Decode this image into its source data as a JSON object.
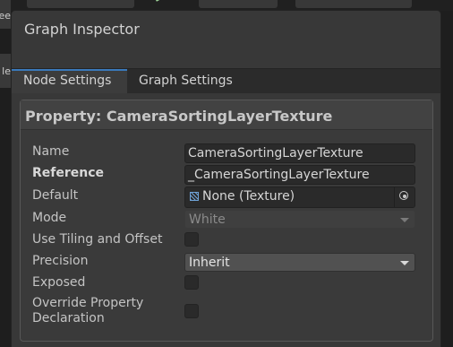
{
  "background": {
    "left_labels": [
      "ee",
      "le"
    ]
  },
  "panel": {
    "title": "Graph Inspector",
    "tabs": [
      {
        "label": "Node Settings",
        "active": true
      },
      {
        "label": "Graph Settings",
        "active": false
      }
    ]
  },
  "property": {
    "header": "Property: CameraSortingLayerTexture",
    "rows": {
      "name": {
        "label": "Name",
        "value": "CameraSortingLayerTexture"
      },
      "reference": {
        "label": "Reference",
        "value": "_CameraSortingLayerTexture"
      },
      "default": {
        "label": "Default",
        "value": "None (Texture)",
        "icon": "texture-icon"
      },
      "mode": {
        "label": "Mode",
        "value": "White",
        "enabled": false
      },
      "tiling": {
        "label": "Use Tiling and Offset",
        "checked": false
      },
      "precision": {
        "label": "Precision",
        "value": "Inherit"
      },
      "exposed": {
        "label": "Exposed",
        "checked": false
      },
      "override": {
        "label_line1": "Override Property",
        "label_line2": "Declaration",
        "checked": false
      }
    }
  },
  "colors": {
    "accent": "#3a79bb",
    "panel_bg": "#383838",
    "field_bg": "#2a2a2a"
  }
}
